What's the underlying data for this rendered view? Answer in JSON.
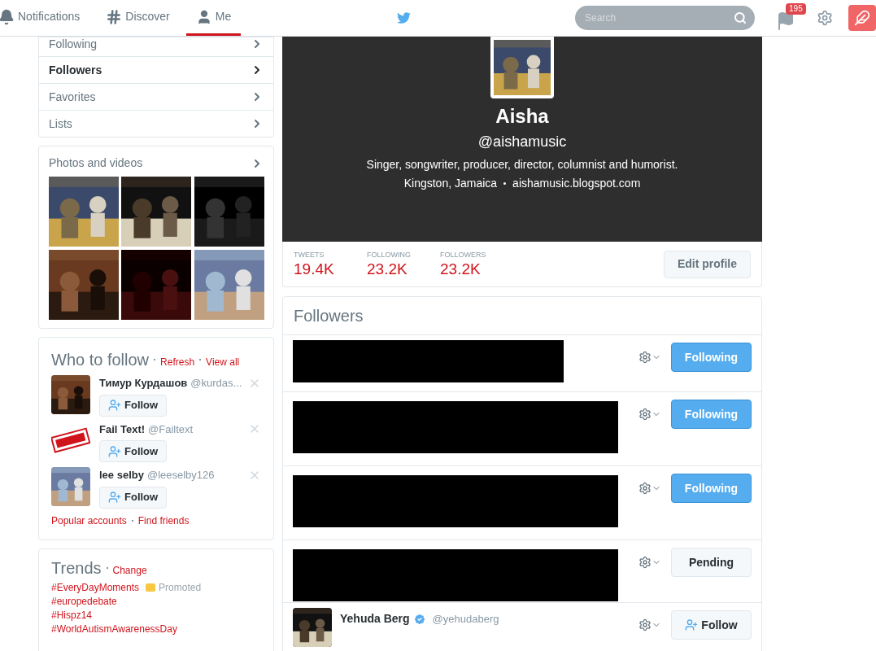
{
  "nav": {
    "tabs": [
      {
        "label": "Notifications",
        "kind": "bell",
        "selected": false
      },
      {
        "label": "Discover",
        "kind": "hash",
        "selected": false
      },
      {
        "label": "Me",
        "kind": "person",
        "selected": true
      }
    ],
    "search": {
      "placeholder": "Search"
    },
    "messages_badge": "195"
  },
  "sidebar": {
    "menu": [
      {
        "label": "Following",
        "selected": false
      },
      {
        "label": "Followers",
        "selected": true
      },
      {
        "label": "Favorites",
        "selected": false
      },
      {
        "label": "Lists",
        "selected": false
      }
    ],
    "photos": {
      "title": "Photos and videos"
    },
    "who_to_follow": {
      "title": "Who to follow",
      "links": [
        "Refresh",
        "View all"
      ],
      "suggestions": [
        {
          "name": "Тимур Курдашов",
          "handle": "@kurdas...",
          "button": "Follow"
        },
        {
          "name": "Fail Text!",
          "handle": "@Failtext",
          "button": "Follow"
        },
        {
          "name": "lee selby",
          "handle": "@leeselby126",
          "button": "Follow"
        }
      ],
      "footer_links": [
        "Popular accounts",
        "Find friends"
      ]
    },
    "trends": {
      "title": "Trends",
      "change": "Change",
      "items": [
        {
          "tag": "#EveryDayMoments",
          "promoted": "Promoted"
        },
        {
          "tag": "#europedebate"
        },
        {
          "tag": "#Hispz14"
        },
        {
          "tag": "#WorldAutismAwarenessDay"
        }
      ]
    }
  },
  "profile": {
    "name": "Aisha",
    "handle": "@aishamusic",
    "bio": "Singer, songwriter, producer, director, columnist and humorist.",
    "location": "Kingston, Jamaica",
    "website": "aishamusic.blogspot.com",
    "stats": [
      {
        "label": "TWEETS",
        "value": "19.4K"
      },
      {
        "label": "FOLLOWING",
        "value": "23.2K"
      },
      {
        "label": "FOLLOWERS",
        "value": "23.2K"
      }
    ],
    "edit_button": "Edit profile"
  },
  "followers": {
    "title": "Followers",
    "rows": [
      {
        "kind": "redacted",
        "button": {
          "kind": "following",
          "label": "Following"
        }
      },
      {
        "kind": "redacted",
        "button": {
          "kind": "following",
          "label": "Following"
        }
      },
      {
        "kind": "redacted",
        "button": {
          "kind": "following",
          "label": "Following"
        }
      },
      {
        "kind": "redacted",
        "button": {
          "kind": "pending",
          "label": "Pending"
        }
      },
      {
        "kind": "user",
        "name": "Yehuda Berg",
        "verified": true,
        "handle": "@yehudaberg",
        "button": {
          "kind": "follow",
          "label": "Follow"
        }
      }
    ]
  }
}
